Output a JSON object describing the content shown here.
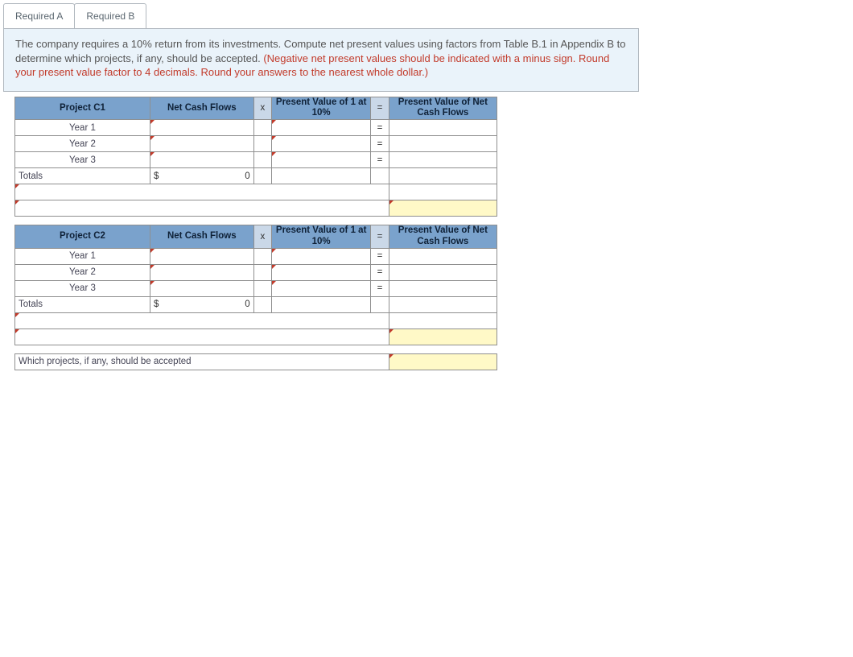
{
  "tabs": {
    "a": "Required A",
    "b": "Required B"
  },
  "instruction": {
    "black": "The company requires a 10% return from its investments. Compute net present values using factors from Table B.1 in Appendix B to determine which projects, if any, should be accepted. ",
    "red": "(Negative net present values should be indicated with a minus sign. Round your present value factor to 4 decimals. Round your answers to the nearest whole dollar.)"
  },
  "headers": {
    "netcash": "Net Cash Flows",
    "x": "x",
    "pvfactor": "Present Value of 1 at 10%",
    "eq": "=",
    "pvnet": "Present Value of Net Cash Flows"
  },
  "projects": {
    "c1": {
      "title": "Project C1",
      "rows": [
        "Year 1",
        "Year 2",
        "Year 3"
      ],
      "totals_label": "Totals",
      "totals_sym": "$",
      "totals_val": "0"
    },
    "c2": {
      "title": "Project C2",
      "rows": [
        "Year 1",
        "Year 2",
        "Year 3"
      ],
      "totals_label": "Totals",
      "totals_sym": "$",
      "totals_val": "0"
    }
  },
  "final_question": "Which projects, if any, should be accepted",
  "ops": {
    "eq": "="
  }
}
